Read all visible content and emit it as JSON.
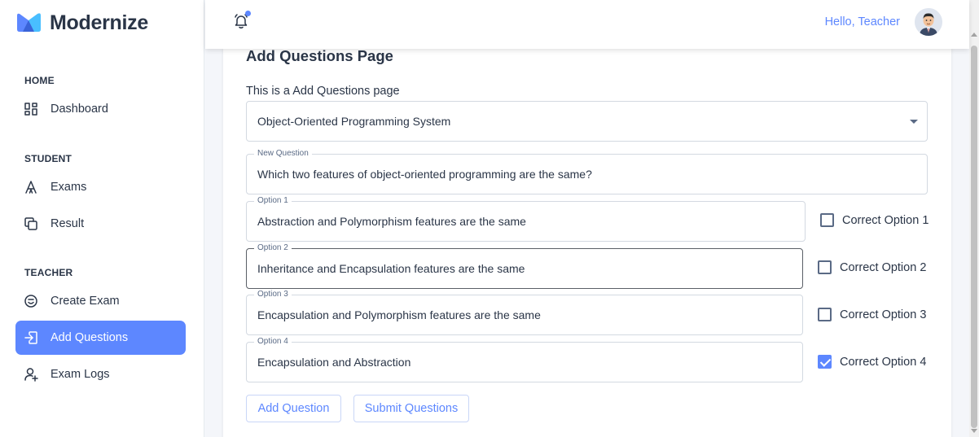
{
  "brand": {
    "name": "Modernize"
  },
  "sidebar": {
    "sections": [
      {
        "heading": "HOME",
        "items": [
          {
            "label": "Dashboard",
            "icon": "dashboard-icon"
          }
        ]
      },
      {
        "heading": "STUDENT",
        "items": [
          {
            "label": "Exams",
            "icon": "exams-icon"
          },
          {
            "label": "Result",
            "icon": "result-icon"
          }
        ]
      },
      {
        "heading": "TEACHER",
        "items": [
          {
            "label": "Create Exam",
            "icon": "create-exam-icon"
          },
          {
            "label": "Add Questions",
            "icon": "add-questions-icon",
            "active": true
          },
          {
            "label": "Exam Logs",
            "icon": "exam-logs-icon"
          }
        ]
      }
    ]
  },
  "header": {
    "greeting": "Hello, Teacher",
    "notification_icon": "bell-icon",
    "has_notification": true
  },
  "page": {
    "title": "Add Questions Page",
    "subtitle": "This is a Add Questions page",
    "exam_select": {
      "value": "Object-Oriented Programming System"
    },
    "question": {
      "label": "New Question",
      "value": "Which two features of object-oriented programming are the same?"
    },
    "options": [
      {
        "label": "Option 1",
        "value": "Abstraction and Polymorphism features are the same",
        "check_label": "Correct Option 1",
        "correct": false
      },
      {
        "label": "Option 2",
        "value": "Inheritance and Encapsulation features are the same",
        "check_label": "Correct Option 2",
        "correct": false
      },
      {
        "label": "Option 3",
        "value": "Encapsulation and Polymorphism features are the same",
        "check_label": "Correct Option 3",
        "correct": false
      },
      {
        "label": "Option 4",
        "value": "Encapsulation and Abstraction",
        "check_label": "Correct Option 4",
        "correct": true
      }
    ],
    "buttons": {
      "add": "Add Question",
      "submit": "Submit Questions"
    }
  },
  "colors": {
    "primary": "#5d87ff",
    "text": "#2a3547",
    "background": "#f4f6fa"
  }
}
